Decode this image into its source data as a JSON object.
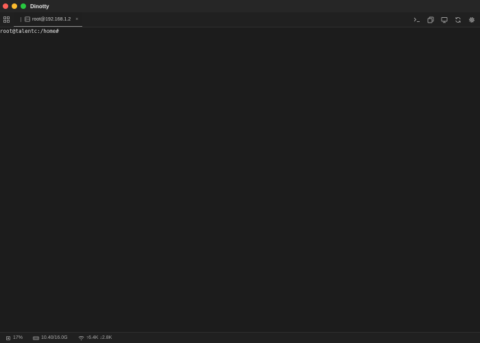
{
  "window": {
    "title": "Dinotty"
  },
  "tabs": [
    {
      "label": "root@192.168.1.2",
      "close": "×",
      "active": true
    }
  ],
  "terminal": {
    "lines": [
      "root@talentc:/home#"
    ]
  },
  "toolbar": {
    "icons": [
      "terminal-prompt-icon",
      "copy-windows-icon",
      "monitor-icon",
      "refresh-icon",
      "settings-gear-icon"
    ]
  },
  "status": {
    "cpu": "17%",
    "memory": "10.40/16.0G",
    "network": "↑6.4K ↓2.8K"
  },
  "colors": {
    "close": "#fe5f57",
    "minimize": "#febc2e",
    "maximize": "#28c840",
    "background": "#1c1c1c"
  }
}
